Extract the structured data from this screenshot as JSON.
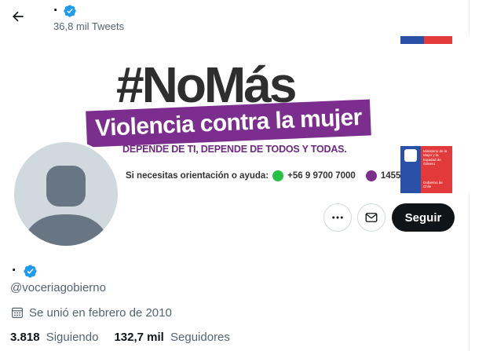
{
  "header": {
    "back_icon": "arrow-left-icon",
    "name": "·",
    "verified_icon": "verified-badge-icon",
    "tweet_count": "36,8 mil Tweets"
  },
  "banner": {
    "hashtag": "#NoMás",
    "headline": "Violencia contra la mujer",
    "tagline": "DEPENDE DE TI, DEPENDE DE TODOS Y TODAS.",
    "help_label": "Si necesitas orientación o ayuda:",
    "whatsapp_icon": "whatsapp-icon",
    "whatsapp_number": "+56 9 9700 7000",
    "phone_icon": "phone-icon",
    "phone_number": "1455",
    "ministry_text": "Ministerio de la Mujer y la Equidad de Género",
    "ministry_sub": "Gobierno de Chile"
  },
  "actions": {
    "more_icon": "more-dots-icon",
    "message_icon": "mail-icon",
    "follow_label": "Seguir"
  },
  "profile": {
    "name": "·",
    "handle": "@voceriagobierno",
    "calendar_icon": "calendar-icon",
    "joined": "Se unió en febrero de 2010",
    "following_count": "3.818",
    "following_label": "Siguiendo",
    "followers_count": "132,7 mil",
    "followers_label": "Seguidores"
  },
  "colors": {
    "verified": "#1d9bf0",
    "purple": "#7b2e8e",
    "follow_bg": "#0f1419"
  }
}
